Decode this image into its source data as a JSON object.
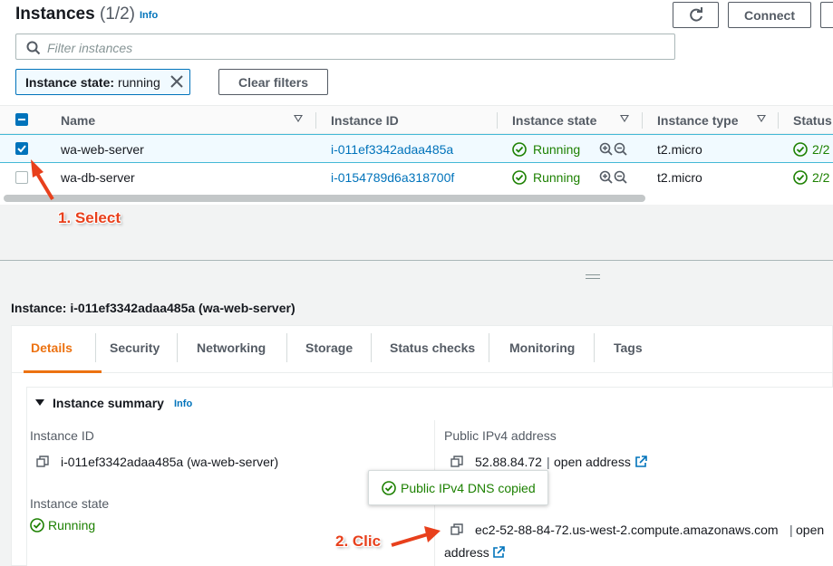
{
  "header": {
    "title": "Instances",
    "count": "(1/2)",
    "info": "Info",
    "connect_label": "Connect"
  },
  "search": {
    "placeholder": "Filter instances"
  },
  "filter_token": {
    "key": "Instance state:",
    "value": "running"
  },
  "clear_filters_label": "Clear filters",
  "columns": [
    "Name",
    "Instance ID",
    "Instance state",
    "Instance type",
    "Status"
  ],
  "rows": [
    {
      "name": "wa-web-server",
      "id": "i-011ef3342adaa485a",
      "state": "Running",
      "type": "t2.micro",
      "status": "2/2",
      "selected": true
    },
    {
      "name": "wa-db-server",
      "id": "i-0154789d6a318700f",
      "state": "Running",
      "type": "t2.micro",
      "status": "2/2",
      "selected": false
    }
  ],
  "annotations": {
    "select": "1. Select",
    "click": "2. Clic"
  },
  "details": {
    "title": "Instance: i-011ef3342adaa485a (wa-web-server)",
    "tabs": [
      "Details",
      "Security",
      "Networking",
      "Storage",
      "Status checks",
      "Monitoring",
      "Tags"
    ],
    "active_tab": "Details",
    "summary_heading": "Instance summary",
    "summary_info": "Info",
    "instance_id_label": "Instance ID",
    "instance_id_value": "i-011ef3342adaa485a (wa-web-server)",
    "instance_state_label": "Instance state",
    "instance_state_value": "Running",
    "public_ipv4_label": "Public IPv4 address",
    "public_ipv4_value": "52.88.84.72",
    "open_address": "open address",
    "dns_value": "ec2-52-88-84-72.us-west-2.compute.amazonaws.com",
    "dns_open_1": "open",
    "dns_open_2": "address",
    "sep_char": "|"
  },
  "toast": {
    "message": "Public IPv4 DNS copied"
  },
  "colors": {
    "accent": "#0073bb",
    "success": "#1d8102",
    "active_tab": "#ec7211",
    "annotation": "#e8401c"
  }
}
